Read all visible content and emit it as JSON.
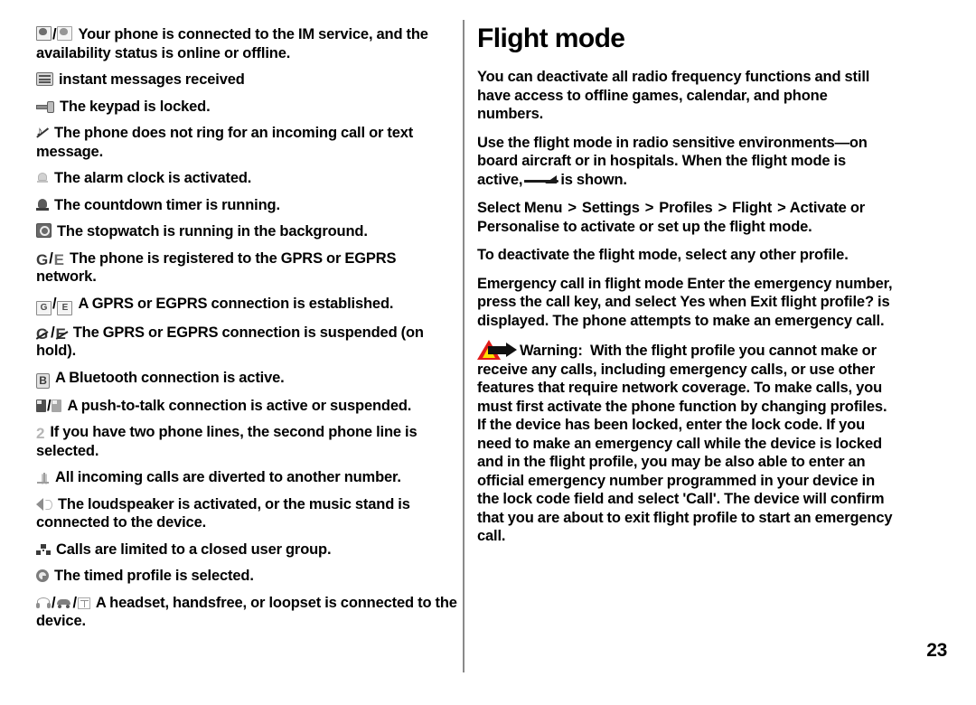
{
  "page": {
    "number": "23",
    "separator": "/"
  },
  "left_column": {
    "name": "indicator-list",
    "entries": [
      {
        "icons": [
          "im-online-icon",
          "im-offline-icon"
        ],
        "text": "Your phone is connected to the IM service, and the availability status is online or offline."
      },
      {
        "icons": [
          "instant-message-received-icon"
        ],
        "text": "instant messages received"
      },
      {
        "icons": [
          "keypad-locked-icon"
        ],
        "text": "The keypad is locked."
      },
      {
        "icons": [
          "silent-ringtone-icon"
        ],
        "text": "The phone does not ring for an incoming call or text message."
      },
      {
        "icons": [
          "alarm-clock-icon"
        ],
        "text": "The alarm clock is activated."
      },
      {
        "icons": [
          "countdown-timer-icon"
        ],
        "text": "The countdown timer is running."
      },
      {
        "icons": [
          "stopwatch-icon"
        ],
        "text": "The stopwatch is running in the background."
      },
      {
        "icons": [
          "gprs-registered-icon",
          "egprs-registered-icon"
        ],
        "glyph_labels": [
          "G",
          "E"
        ],
        "text": "The phone is registered to the GPRS or EGPRS network."
      },
      {
        "icons": [
          "gprs-connection-icon",
          "egprs-connection-icon"
        ],
        "glyph_labels": [
          "G",
          "E"
        ],
        "text": "A GPRS or EGPRS connection is established."
      },
      {
        "icons": [
          "gprs-suspended-icon",
          "egprs-suspended-icon"
        ],
        "glyph_labels": [
          "G",
          "E"
        ],
        "text": "The GPRS or EGPRS connection is suspended (on hold)."
      },
      {
        "icons": [
          "bluetooth-active-icon"
        ],
        "glyph_labels": [
          "B"
        ],
        "text": "A Bluetooth connection is active."
      },
      {
        "icons": [
          "push-to-talk-active-icon",
          "push-to-talk-suspended-icon"
        ],
        "text": "A push-to-talk connection is active or suspended."
      },
      {
        "icons": [
          "second-phone-line-icon"
        ],
        "glyph_labels": [
          "2"
        ],
        "text": "If you have two phone lines, the second phone line is selected."
      },
      {
        "icons": [
          "call-divert-icon"
        ],
        "text": "All incoming calls are diverted to another number."
      },
      {
        "icons": [
          "loudspeaker-icon"
        ],
        "text": "The loudspeaker is activated, or the music stand is connected to the device."
      },
      {
        "icons": [
          "closed-user-group-icon"
        ],
        "text": "Calls are limited to a closed user group."
      },
      {
        "icons": [
          "timed-profile-icon"
        ],
        "text": "The timed profile is selected."
      },
      {
        "icons": [
          "headset-icon",
          "handsfree-icon",
          "loopset-icon"
        ],
        "text": "A headset, handsfree, or loopset is connected to the device."
      }
    ]
  },
  "right_column": {
    "title": "Flight mode",
    "paragraph_1": "You can deactivate all radio frequency functions and still have access to offline games, calendar, and phone numbers.",
    "paragraph_2_part_1": "Use the flight mode in radio sensitive environments—on board aircraft or in hospitals. When the flight mode is active,",
    "paragraph_2_part_2": "is shown.",
    "paragraph_2_icon": "flight-mode-airplane-icon",
    "menu_path": {
      "lead": "Select",
      "items": [
        "Menu",
        "Settings",
        "Profiles",
        "Flight"
      ],
      "arrow": ">",
      "option_a": "Activate",
      "conjunction": "or",
      "option_b": "Personalise",
      "tail": "to activate or set up the flight mode."
    },
    "paragraph_3": "To deactivate the flight mode, select any other profile.",
    "emergency": {
      "part_1": "Emergency call in flight mode Enter the emergency number, press the call key, and select",
      "bold_1": "Yes",
      "part_2": "when",
      "bold_2": "Exit flight profile?",
      "part_3": "is displayed. The phone attempts to make an emergency call."
    },
    "warning": {
      "icon": "warning-triangle-arrow-icon",
      "label": "Warning:",
      "text": "With the flight profile you cannot make or receive any calls, including emergency calls, or use other features that require network coverage. To make calls, you must first activate the phone function by changing profiles. If the device has been locked, enter the lock code. If you need to make an emergency call while the device is locked and in the flight profile, you may be also able to enter an official emergency number programmed in your device in the lock code field and select 'Call'. The device will confirm that you are about to exit flight profile to start an emergency call.",
      "colors": {
        "triangle_border": "#e01b18",
        "triangle_fill": "#ffe000",
        "arrow": "#111111"
      }
    }
  }
}
